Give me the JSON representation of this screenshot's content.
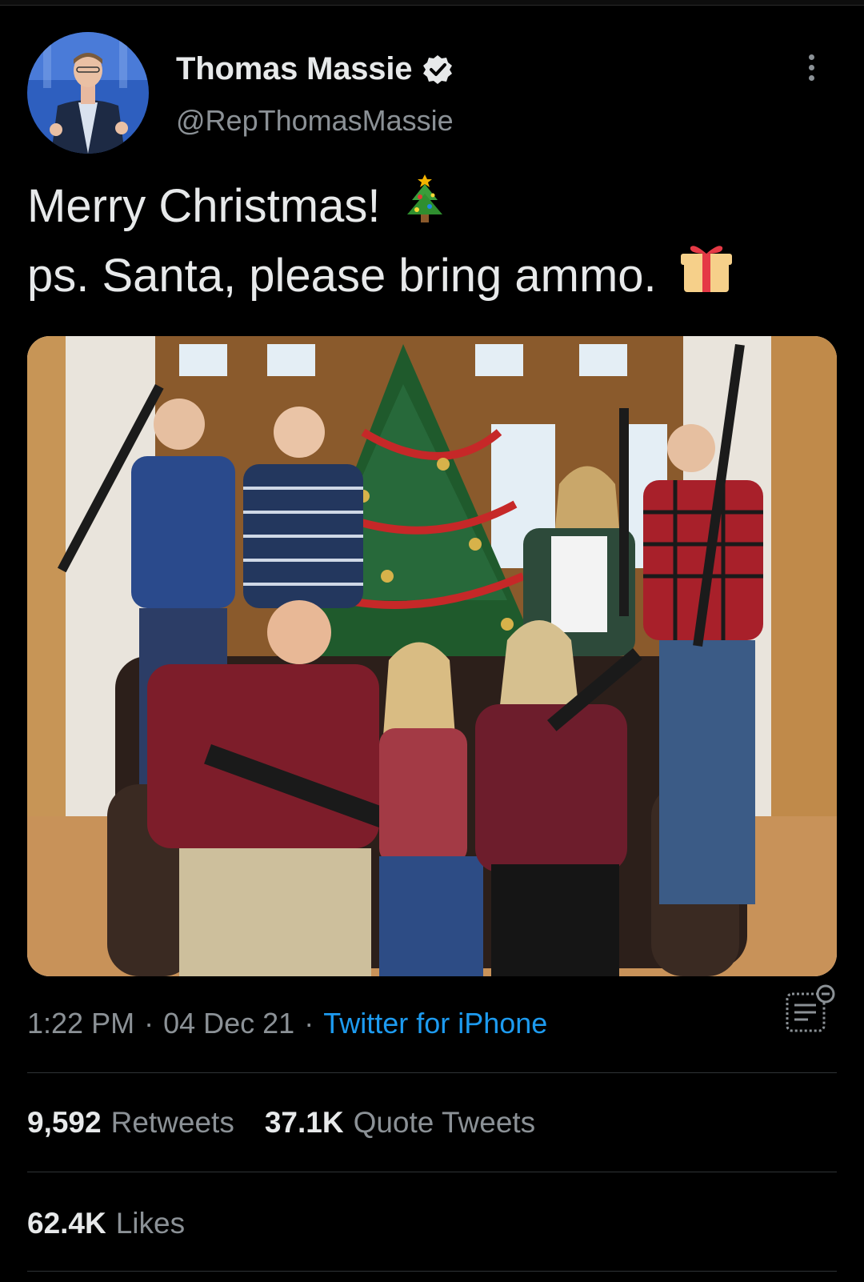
{
  "tweet": {
    "author": {
      "display_name": "Thomas Massie",
      "handle": "@RepThomasMassie",
      "verified": true,
      "avatar_icon": "profile-photo"
    },
    "text_line1": "Merry Christmas!",
    "text_line1_emoji": "christmas-tree-emoji",
    "text_line2": "ps. Santa, please bring ammo.",
    "text_line2_emoji": "wrapped-gift-emoji",
    "media": {
      "type": "photo",
      "icon": "family-christmas-photo"
    },
    "time": "1:22 PM",
    "separator": "·",
    "date": "04 Dec 21",
    "source": "Twitter for iPhone",
    "stats": {
      "retweets_count": "9,592",
      "retweets_label": "Retweets",
      "quotes_count": "37.1K",
      "quotes_label": "Quote Tweets",
      "likes_count": "62.4K",
      "likes_label": "Likes"
    }
  },
  "colors": {
    "background": "#000000",
    "text_primary": "#e7e9ea",
    "text_secondary": "#8b9196",
    "link": "#1d9bf0",
    "divider": "#2f3336"
  }
}
